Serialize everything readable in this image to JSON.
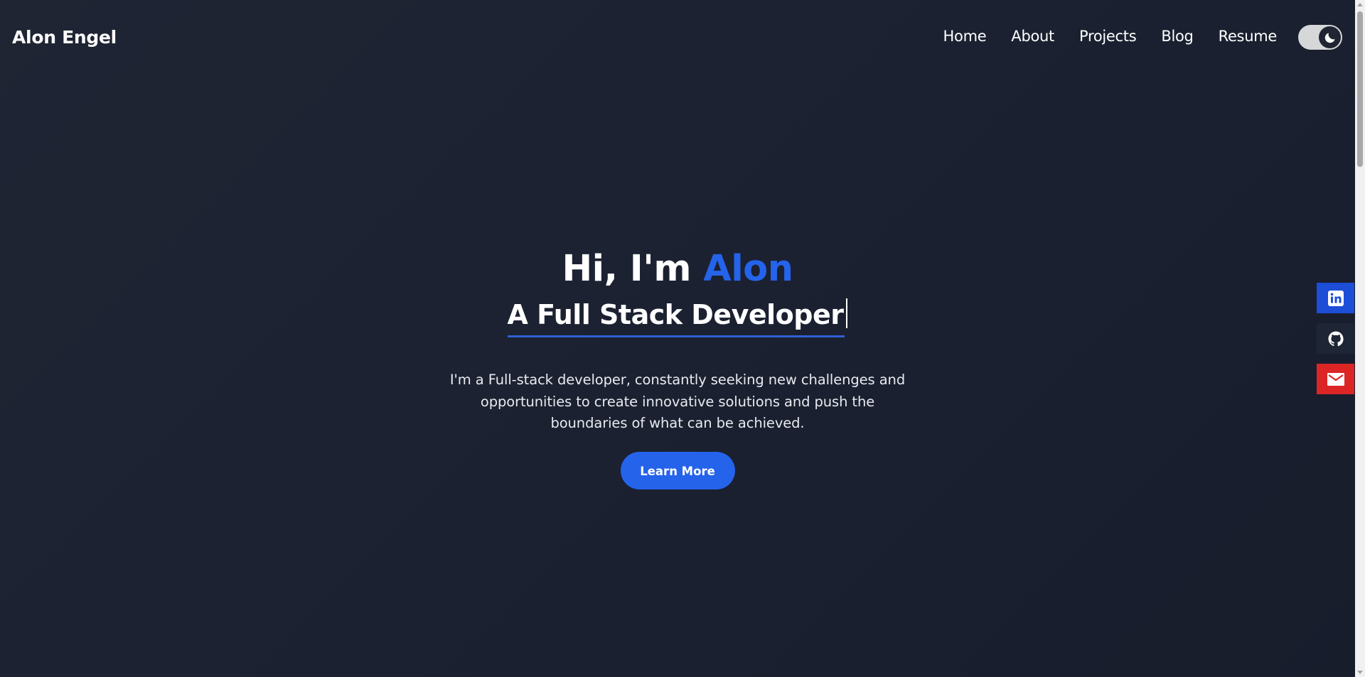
{
  "header": {
    "brand": "Alon Engel",
    "nav": [
      {
        "label": "Home"
      },
      {
        "label": "About"
      },
      {
        "label": "Projects"
      },
      {
        "label": "Blog"
      },
      {
        "label": "Resume"
      }
    ],
    "theme_toggle": {
      "icon": "moon-icon",
      "mode": "dark"
    }
  },
  "hero": {
    "greeting": "Hi, I'm ",
    "name": "Alon",
    "subtitle": "A Full Stack Developer",
    "description": "I'm a Full-stack developer, constantly seeking new challenges and opportunities to create innovative solutions and push the boundaries of what can be achieved.",
    "cta_label": "Learn More"
  },
  "social": [
    {
      "name": "linkedin",
      "icon": "linkedin-icon",
      "color": "#1d4ed8"
    },
    {
      "name": "github",
      "icon": "github-icon",
      "color": "#1e2535"
    },
    {
      "name": "email",
      "icon": "mail-icon",
      "color": "#dc2626"
    }
  ],
  "colors": {
    "background": "#1b2131",
    "accent": "#2563eb",
    "text": "#ffffff"
  }
}
